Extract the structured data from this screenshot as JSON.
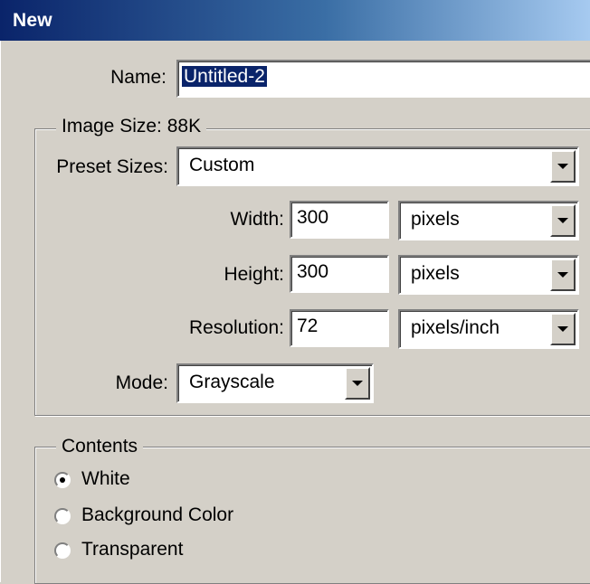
{
  "window": {
    "title": "New"
  },
  "name": {
    "label": "Name:",
    "value": "Untitled-2"
  },
  "image_size": {
    "title": "Image Size: 88K",
    "preset": {
      "label": "Preset Sizes:",
      "value": "Custom"
    },
    "width": {
      "label": "Width:",
      "value": "300",
      "unit": "pixels"
    },
    "height": {
      "label": "Height:",
      "value": "300",
      "unit": "pixels"
    },
    "resolution": {
      "label": "Resolution:",
      "value": "72",
      "unit": "pixels/inch"
    },
    "mode": {
      "label": "Mode:",
      "value": "Grayscale"
    }
  },
  "contents": {
    "title": "Contents",
    "options": [
      {
        "label": "White",
        "selected": true
      },
      {
        "label": "Background Color",
        "selected": false
      },
      {
        "label": "Transparent",
        "selected": false
      }
    ]
  },
  "colors": {
    "title_start": "#0a246a",
    "title_end": "#a6caf0",
    "face": "#d4d0c8",
    "selection": "#0a246a"
  },
  "icons": {
    "dropdown": "chevron-down-icon",
    "radio": "radio-icon"
  }
}
